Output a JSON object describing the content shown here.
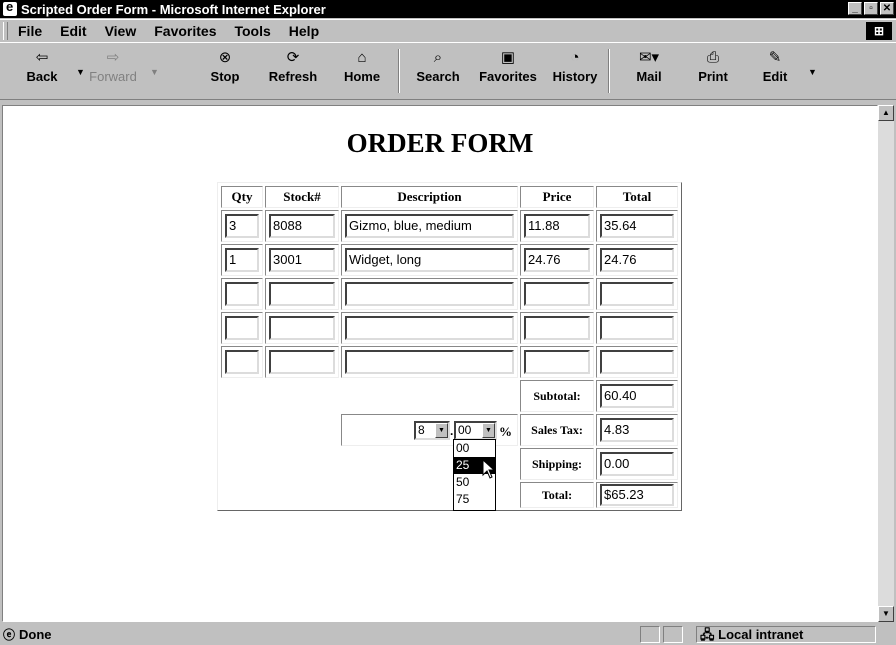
{
  "window": {
    "title": "Scripted Order Form - Microsoft Internet Explorer"
  },
  "menu": [
    "File",
    "Edit",
    "View",
    "Favorites",
    "Tools",
    "Help"
  ],
  "toolbar": {
    "back": "Back",
    "forward": "Forward",
    "stop": "Stop",
    "refresh": "Refresh",
    "home": "Home",
    "search": "Search",
    "favorites": "Favorites",
    "history": "History",
    "mail": "Mail",
    "print": "Print",
    "edit": "Edit"
  },
  "page": {
    "title": "ORDER FORM"
  },
  "table": {
    "headers": {
      "qty": "Qty",
      "stock": "Stock#",
      "desc": "Description",
      "price": "Price",
      "total": "Total"
    },
    "rows": [
      {
        "qty": "3",
        "stock": "8088",
        "desc": "Gizmo, blue, medium",
        "price": "11.88",
        "total": "35.64"
      },
      {
        "qty": "1",
        "stock": "3001",
        "desc": "Widget, long",
        "price": "24.76",
        "total": "24.76"
      },
      {
        "qty": "",
        "stock": "",
        "desc": "",
        "price": "",
        "total": ""
      },
      {
        "qty": "",
        "stock": "",
        "desc": "",
        "price": "",
        "total": ""
      },
      {
        "qty": "",
        "stock": "",
        "desc": "",
        "price": "",
        "total": ""
      }
    ],
    "subtotal_label": "Subtotal:",
    "subtotal": "60.40",
    "tax_label": "Sales Tax:",
    "tax": "4.83",
    "shipping_label": "Shipping:",
    "shipping": "0.00",
    "total_label": "Total:",
    "total": "$65.23",
    "tax_rate": {
      "whole": "8",
      "dot": ".",
      "decimal": "00",
      "percent": "%"
    },
    "decimal_options": [
      "00",
      "25",
      "50",
      "75"
    ],
    "highlighted_option": "25"
  },
  "status": {
    "text": "Done",
    "zone": "Local intranet"
  }
}
